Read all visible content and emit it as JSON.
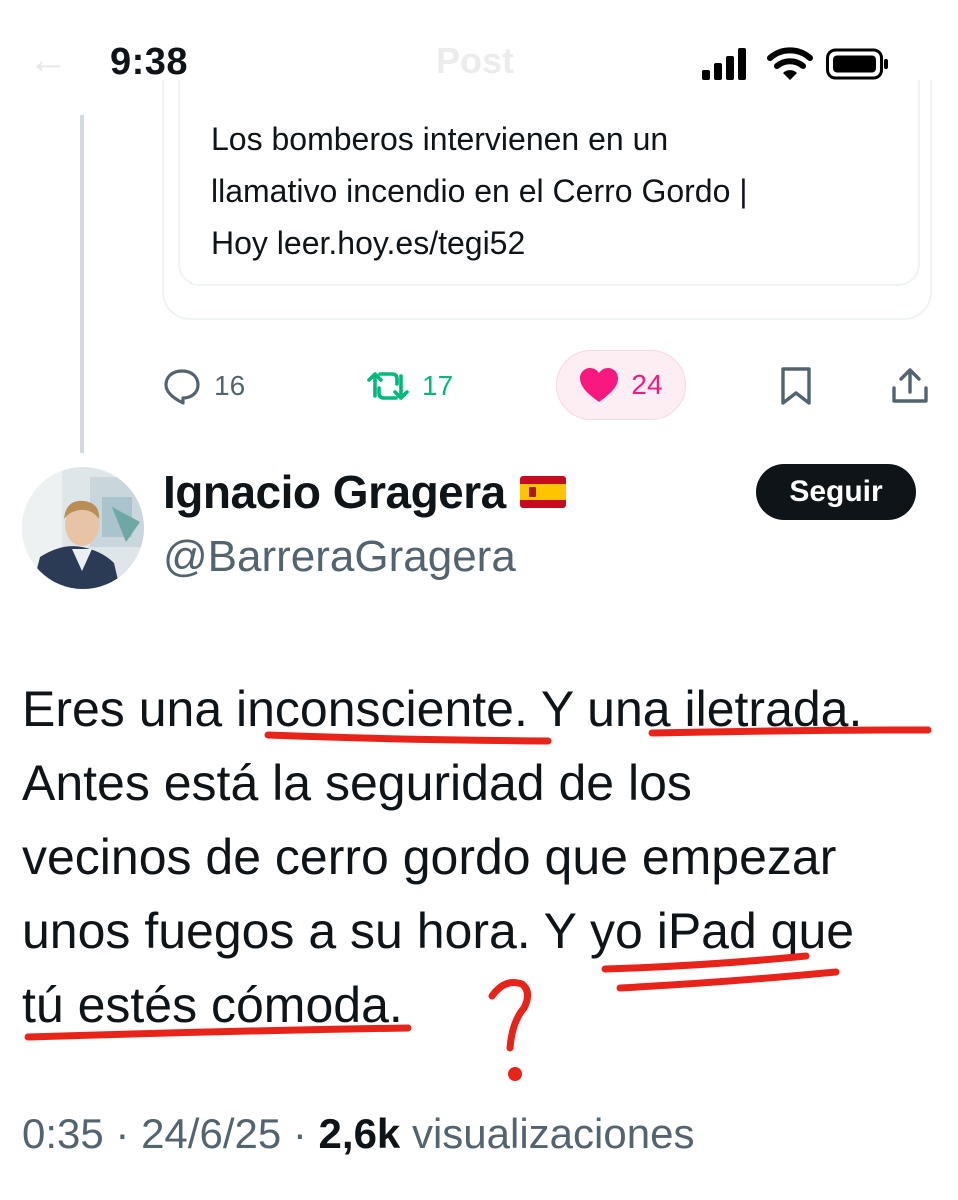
{
  "status_bar": {
    "time": "9:38"
  },
  "nav": {
    "title": "Post"
  },
  "quoted_card": {
    "lines": [
      "Los bomberos intervienen en un",
      "llamativo incendio en el Cerro Gordo |",
      "Hoy leer.hoy.es/tegi52"
    ]
  },
  "actions": {
    "reply_count": "16",
    "retweet_count": "17",
    "like_count": "24",
    "liked": true
  },
  "reply": {
    "author_name": "Ignacio Gragera",
    "author_handle": "@BarreraGragera",
    "follow_label": "Seguir",
    "flag_icon": "spain-flag-icon",
    "text_lines": [
      "Eres una inconsciente. Y una iletrada.",
      "Antes está la seguridad de los",
      "vecinos de cerro gordo que empezar",
      "unos fuegos a su hora. Y yo iPad que",
      "tú estés cómoda."
    ],
    "time": "0:35",
    "date": "24/6/25",
    "views_count": "2,6k",
    "views_label": "visualizaciones"
  },
  "annotation": {
    "question_mark": "?"
  },
  "colors": {
    "text": "#0f1419",
    "secondary": "#536471",
    "retweet": "#00ba7c",
    "like": "#f91880",
    "annotation": "#e8231a"
  }
}
